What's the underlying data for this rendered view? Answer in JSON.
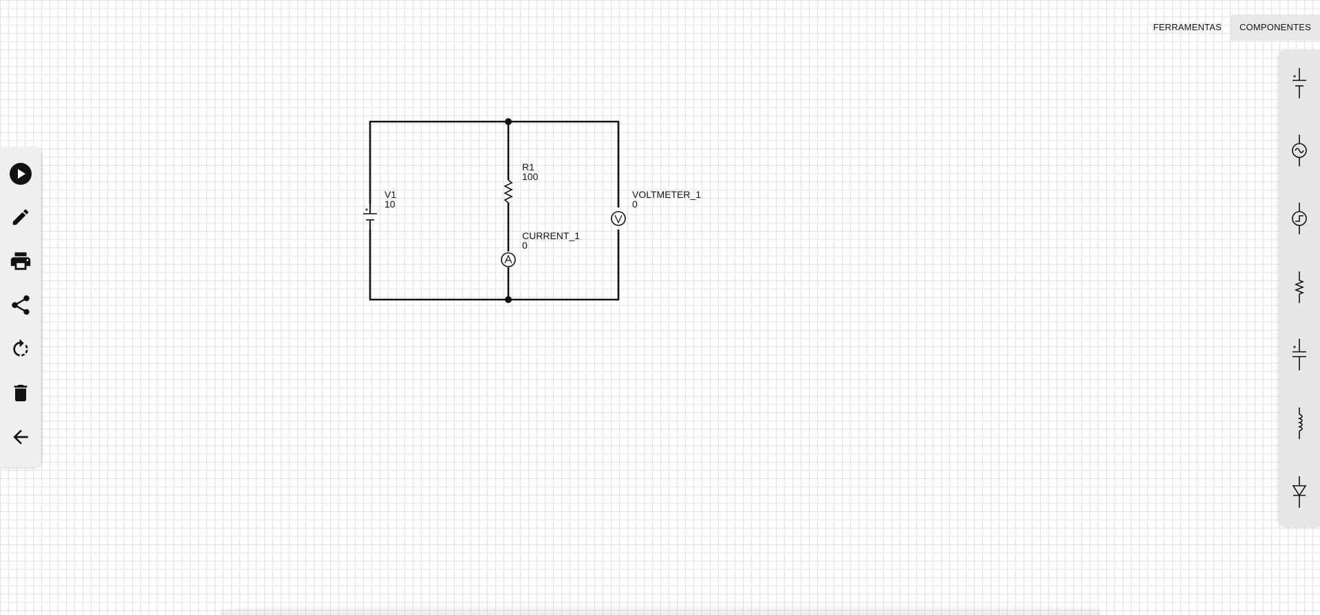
{
  "tabs": [
    {
      "label": "FERRAMENTAS",
      "active": false
    },
    {
      "label": "COMPONENTES",
      "active": true
    }
  ],
  "left_toolbar": {
    "tools": [
      {
        "icon": "play-icon",
        "action": "simulate"
      },
      {
        "icon": "pencil-icon",
        "action": "edit"
      },
      {
        "icon": "print-icon",
        "action": "print"
      },
      {
        "icon": "share-icon",
        "action": "share"
      },
      {
        "icon": "rotate-icon",
        "action": "rotate"
      },
      {
        "icon": "trash-icon",
        "action": "delete"
      },
      {
        "icon": "arrow-left-icon",
        "action": "back"
      }
    ]
  },
  "components_palette": [
    {
      "icon": "dc-source-icon"
    },
    {
      "icon": "ac-source-icon"
    },
    {
      "icon": "pulse-source-icon"
    },
    {
      "icon": "resistor-icon"
    },
    {
      "icon": "capacitor-icon"
    },
    {
      "icon": "inductor-icon"
    },
    {
      "icon": "diode-icon"
    }
  ],
  "circuit": {
    "components": [
      {
        "id": "v1",
        "name": "V1",
        "value": "10"
      },
      {
        "id": "r1",
        "name": "R1",
        "value": "100"
      },
      {
        "id": "current_1",
        "name": "CURRENT_1",
        "value": "0"
      },
      {
        "id": "voltmeter_1",
        "name": "VOLTMETER_1",
        "value": "0"
      }
    ]
  },
  "colors": {
    "wire": "#111111",
    "grid": "#e3e3e3",
    "panel": "#e6e6e6",
    "active_tab": "#e8e8e8"
  }
}
